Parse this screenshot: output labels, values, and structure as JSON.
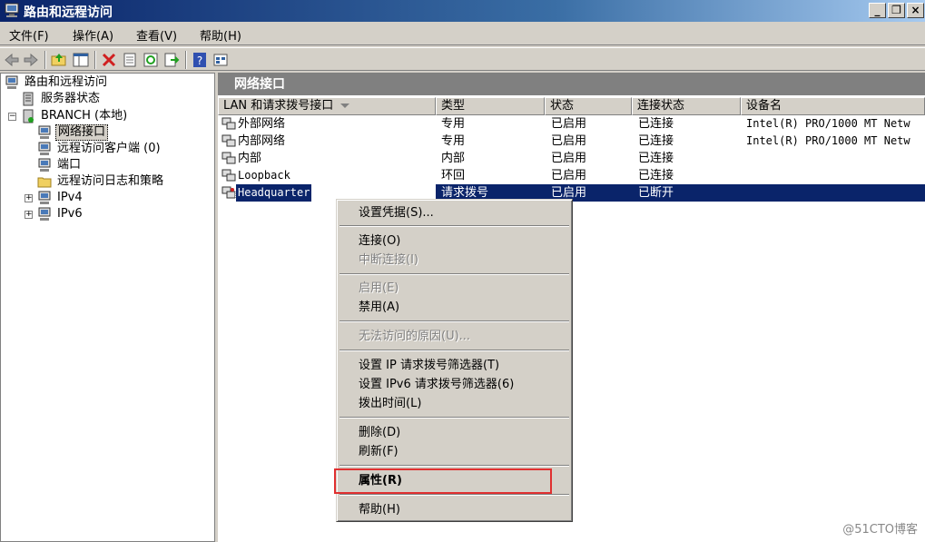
{
  "window": {
    "title": "路由和远程访问",
    "buttons": {
      "minimize": "_",
      "restore": "❐",
      "close": "×"
    }
  },
  "menu": [
    "文件(F)",
    "操作(A)",
    "查看(V)",
    "帮助(H)"
  ],
  "toolbar": {
    "icons": [
      "back-icon",
      "forward-icon",
      "up-folder-icon",
      "show-hide-tree-icon",
      "delete-icon",
      "properties-icon",
      "refresh-icon",
      "export-icon",
      "help-icon",
      "view-icon"
    ]
  },
  "tree": {
    "items": [
      {
        "label": "路由和远程访问",
        "icon": "computer-icon"
      },
      {
        "label": "服务器状态",
        "icon": "server-status-icon"
      },
      {
        "label": "BRANCH (本地)",
        "icon": "server-icon",
        "expander": "−"
      },
      {
        "label": "网络接口",
        "icon": "network-interface-icon"
      },
      {
        "label": "远程访问客户端 (0)",
        "icon": "clients-icon"
      },
      {
        "label": "端口",
        "icon": "ports-icon"
      },
      {
        "label": "远程访问日志和策略",
        "icon": "folder-icon"
      },
      {
        "label": "IPv4",
        "icon": "ipv4-icon",
        "expander": "+"
      },
      {
        "label": "IPv6",
        "icon": "ipv6-icon",
        "expander": "+"
      }
    ]
  },
  "right": {
    "header": "网络接口",
    "columns": [
      "LAN 和请求拨号接口",
      "类型",
      "状态",
      "连接状态",
      "设备名"
    ],
    "rows": [
      {
        "name": "外部网络",
        "type": "专用",
        "status": "已启用",
        "conn": "已连接",
        "device": "Intel(R) PRO/1000 MT Netw"
      },
      {
        "name": "内部网络",
        "type": "专用",
        "status": "已启用",
        "conn": "已连接",
        "device": "Intel(R) PRO/1000 MT Netw"
      },
      {
        "name": "内部",
        "type": "内部",
        "status": "已启用",
        "conn": "已连接",
        "device": ""
      },
      {
        "name": "Loopback",
        "type": "环回",
        "status": "已启用",
        "conn": "已连接",
        "device": ""
      },
      {
        "name": "Headquarter",
        "type": "请求拨号",
        "status": "已启用",
        "conn": "已断开",
        "device": ""
      }
    ]
  },
  "context_menu": {
    "items": [
      {
        "label": "设置凭据(S)..."
      },
      {
        "label": "连接(O)"
      },
      {
        "label": "中断连接(I)"
      },
      {
        "label": "启用(E)"
      },
      {
        "label": "禁用(A)"
      },
      {
        "label": "无法访问的原因(U)..."
      },
      {
        "label": "设置 IP 请求拨号筛选器(T)"
      },
      {
        "label": "设置 IPv6 请求拨号筛选器(6)"
      },
      {
        "label": "拨出时间(L)"
      },
      {
        "label": "删除(D)"
      },
      {
        "label": "刷新(F)"
      },
      {
        "label": "属性(R)"
      },
      {
        "label": "帮助(H)"
      }
    ]
  },
  "watermark": "@51CTO博客",
  "colors": {
    "selection": "#0a246a",
    "highlight_box": "#e03030"
  }
}
